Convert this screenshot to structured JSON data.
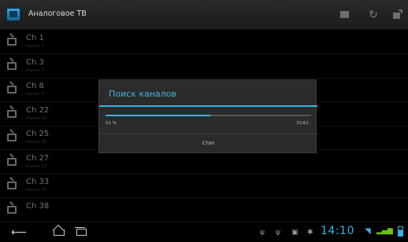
{
  "app": {
    "title": "Аналоговое ТВ"
  },
  "actionbar": {
    "icons": [
      "tv-icon",
      "refresh-icon",
      "settings-icon"
    ]
  },
  "channels": [
    {
      "name": "Ch 1",
      "sub": "Канал 1"
    },
    {
      "name": "Ch 3",
      "sub": "Канал 3"
    },
    {
      "name": "Ch 8",
      "sub": "Канал 8"
    },
    {
      "name": "Ch 22",
      "sub": "Канал 22"
    },
    {
      "name": "Ch 25",
      "sub": "Канал 25"
    },
    {
      "name": "Ch 27",
      "sub": "Канал 27"
    },
    {
      "name": "Ch 33",
      "sub": "Канал 33"
    },
    {
      "name": "Ch 38",
      "sub": ""
    }
  ],
  "dialog": {
    "title": "Поиск каналов",
    "progress_fraction": 0.51,
    "percent_label": "51 %",
    "count_label": "31/61",
    "stop_label": "Стоп"
  },
  "statusbar": {
    "time": "14:10"
  },
  "colors": {
    "accent": "#33b5e5",
    "background": "#000000",
    "dialog": "#2b2b2b",
    "signal": "#6fbf1a"
  }
}
